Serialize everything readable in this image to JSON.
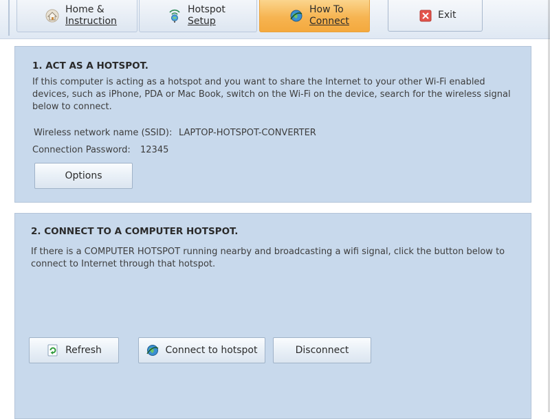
{
  "tabs": {
    "home_line1": "Home &",
    "home_line2": "Instruction",
    "hotspot_line1": "Hotspot",
    "hotspot_line2": "Setup",
    "howto_line1": "How To",
    "howto_line2": "Connect",
    "exit": "Exit"
  },
  "section1": {
    "heading": "1. ACT AS A HOTSPOT.",
    "description": "If this computer is acting as a hotspot and you want to share the Internet to your other Wi-Fi enabled devices, such as iPhone, PDA or Mac Book, switch on the Wi-Fi on the device, search for the wireless signal below to connect.",
    "ssid_label": "Wireless network name (SSID):",
    "ssid_value": "LAPTOP-HOTSPOT-CONVERTER",
    "password_label": "Connection Password:",
    "password_value": "12345",
    "options_button": "Options"
  },
  "section2": {
    "heading": "2. CONNECT TO A COMPUTER HOTSPOT.",
    "description": "If there is a COMPUTER HOTSPOT running nearby and broadcasting a wifi signal, click the button below to connect to Internet through that hotspot.",
    "refresh_button": "Refresh",
    "connect_button": "Connect to hotspot",
    "disconnect_button": "Disconnect"
  },
  "colors": {
    "panel_bg": "#c8d9ec",
    "active_tab": "#f6b451"
  },
  "icons": {
    "home": "home-icon",
    "hotspot": "hotspot-icon",
    "connect": "globe-connect-icon",
    "exit": "exit-icon",
    "refresh": "refresh-icon"
  }
}
